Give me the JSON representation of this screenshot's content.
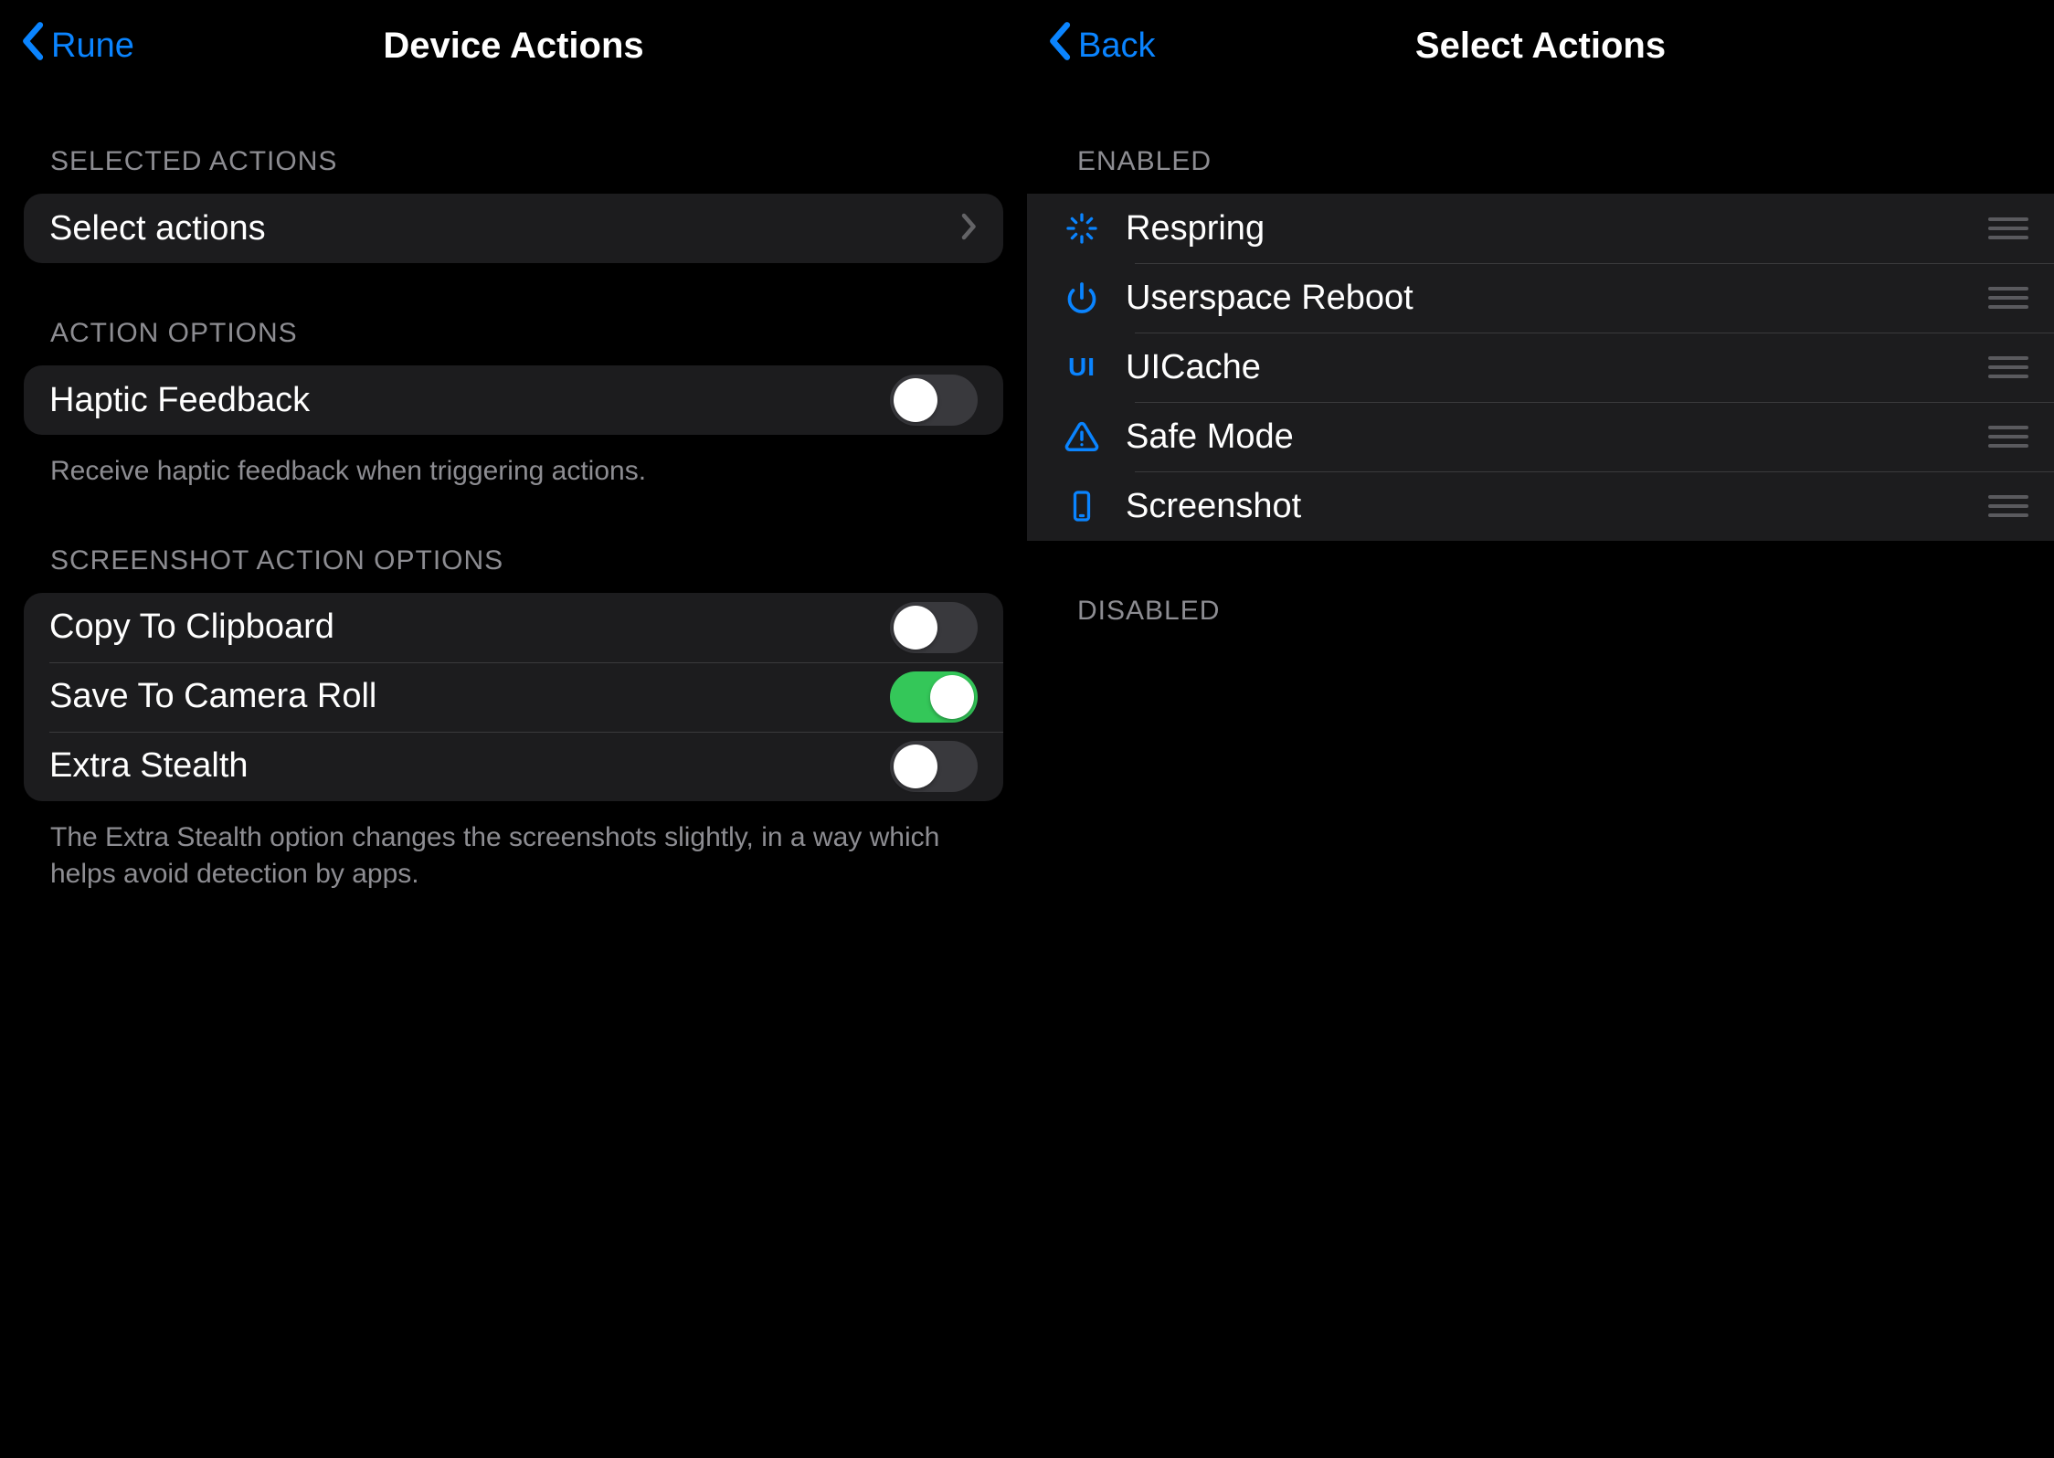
{
  "left": {
    "back_label": "Rune",
    "title": "Device Actions",
    "sections": {
      "selected": {
        "header": "SELECTED ACTIONS",
        "select_actions_label": "Select actions"
      },
      "action_options": {
        "header": "ACTION OPTIONS",
        "haptic_label": "Haptic Feedback",
        "haptic_on": false,
        "footer": "Receive haptic feedback when triggering actions."
      },
      "screenshot_options": {
        "header": "SCREENSHOT ACTION OPTIONS",
        "copy_label": "Copy To Clipboard",
        "copy_on": false,
        "save_label": "Save To Camera Roll",
        "save_on": true,
        "stealth_label": "Extra Stealth",
        "stealth_on": false,
        "footer": "The Extra Stealth option changes the screenshots slightly, in a way which helps avoid detection by apps."
      }
    }
  },
  "right": {
    "back_label": "Back",
    "title": "Select Actions",
    "enabled_header": "ENABLED",
    "disabled_header": "DISABLED",
    "enabled": [
      {
        "icon": "respring-icon",
        "label": "Respring"
      },
      {
        "icon": "power-icon",
        "label": "Userspace Reboot"
      },
      {
        "icon": "ui-icon",
        "label": "UICache"
      },
      {
        "icon": "warning-icon",
        "label": "Safe Mode"
      },
      {
        "icon": "phone-icon",
        "label": "Screenshot"
      }
    ],
    "ui_icon_text": "UI"
  }
}
